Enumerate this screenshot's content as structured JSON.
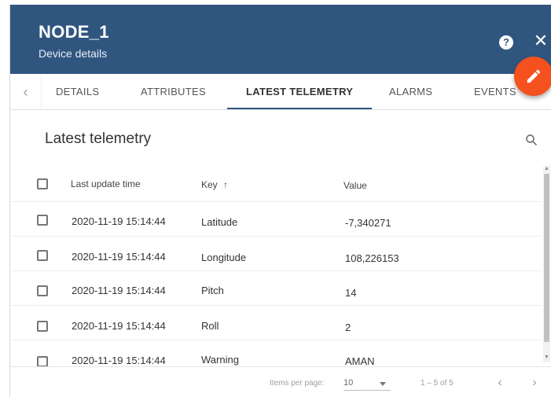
{
  "header": {
    "title": "NODE_1",
    "subtitle": "Device details",
    "help_icon_glyph": "?",
    "close_icon_glyph": "✕"
  },
  "tabs": {
    "prev_glyph": "‹",
    "items": [
      {
        "label": "DETAILS"
      },
      {
        "label": "ATTRIBUTES"
      },
      {
        "label": "LATEST TELEMETRY",
        "active": true
      },
      {
        "label": "ALARMS"
      },
      {
        "label": "EVENTS"
      }
    ]
  },
  "section": {
    "title": "Latest telemetry"
  },
  "table": {
    "columns": {
      "time": "Last update time",
      "key": "Key",
      "key_sort_glyph": "↑",
      "value": "Value"
    },
    "rows": [
      {
        "time": "2020-11-19 15:14:44",
        "key": "Latitude",
        "value": "-7,340271"
      },
      {
        "time": "2020-11-19 15:14:44",
        "key": "Longitude",
        "value": "108,226153"
      },
      {
        "time": "2020-11-19 15:14:44",
        "key": "Pitch",
        "value": "14"
      },
      {
        "time": "2020-11-19 15:14:44",
        "key": "Roll",
        "value": "2"
      },
      {
        "time": "2020-11-19 15:14:44",
        "key": "Warning",
        "value": "AMAN"
      }
    ]
  },
  "paginator": {
    "items_per_page_label": "Items per page:",
    "items_per_page_value": "10",
    "range_label": "1 – 5 of 5",
    "prev_glyph": "‹",
    "next_glyph": "›"
  },
  "colors": {
    "header_bg": "#305680",
    "fab": "#f4511e"
  },
  "icons": {
    "fab": "edit-icon",
    "search": "search-icon",
    "help": "help-icon",
    "close": "close-icon"
  }
}
